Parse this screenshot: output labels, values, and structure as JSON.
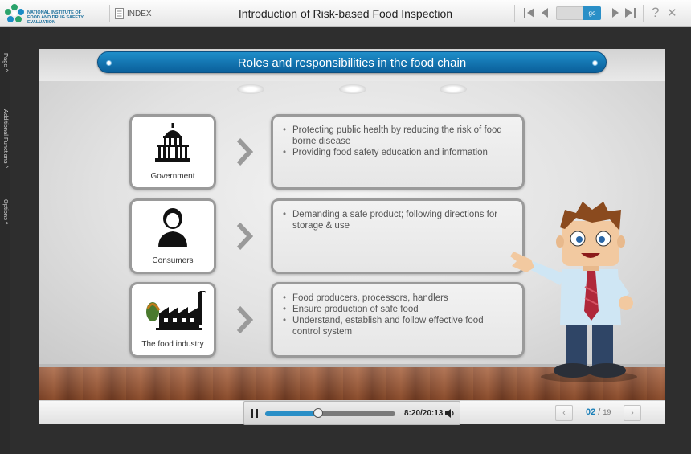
{
  "header": {
    "logo_lines": [
      "NATIONAL INSTITUTE OF",
      "FOOD AND DRUG SAFETY EVALUATION"
    ],
    "index_label": "INDEX",
    "title": "Introduction of Risk-based Food Inspection",
    "go_label": "go",
    "help_icon": "?",
    "close_icon": "✕"
  },
  "rail": {
    "tabs": [
      "Page ^",
      "Additional Functions ^",
      "Options ^"
    ]
  },
  "slide": {
    "title": "Roles and responsibilities in the food chain",
    "roles": [
      {
        "label": "Government",
        "icon": "government-building-icon",
        "bullets": [
          "Protecting public health by reducing the risk of food borne disease",
          "Providing food safety education and information"
        ]
      },
      {
        "label": "Consumers",
        "icon": "person-icon",
        "bullets": [
          "Demanding a safe product; following directions for storage & use"
        ]
      },
      {
        "label": "The food industry",
        "icon": "factory-icon",
        "bullets": [
          "Food producers, processors, handlers",
          "Ensure production of safe food",
          "Understand, establish and follow effective food control system"
        ]
      }
    ]
  },
  "player": {
    "time": "8:20/20:13",
    "progress": 0.41
  },
  "pagination": {
    "current": "02",
    "separator": " / ",
    "total": "19",
    "prev": "‹",
    "next": "›"
  },
  "colors": {
    "accent": "#2a8fc7",
    "title_bar": "#0a5f9b"
  }
}
